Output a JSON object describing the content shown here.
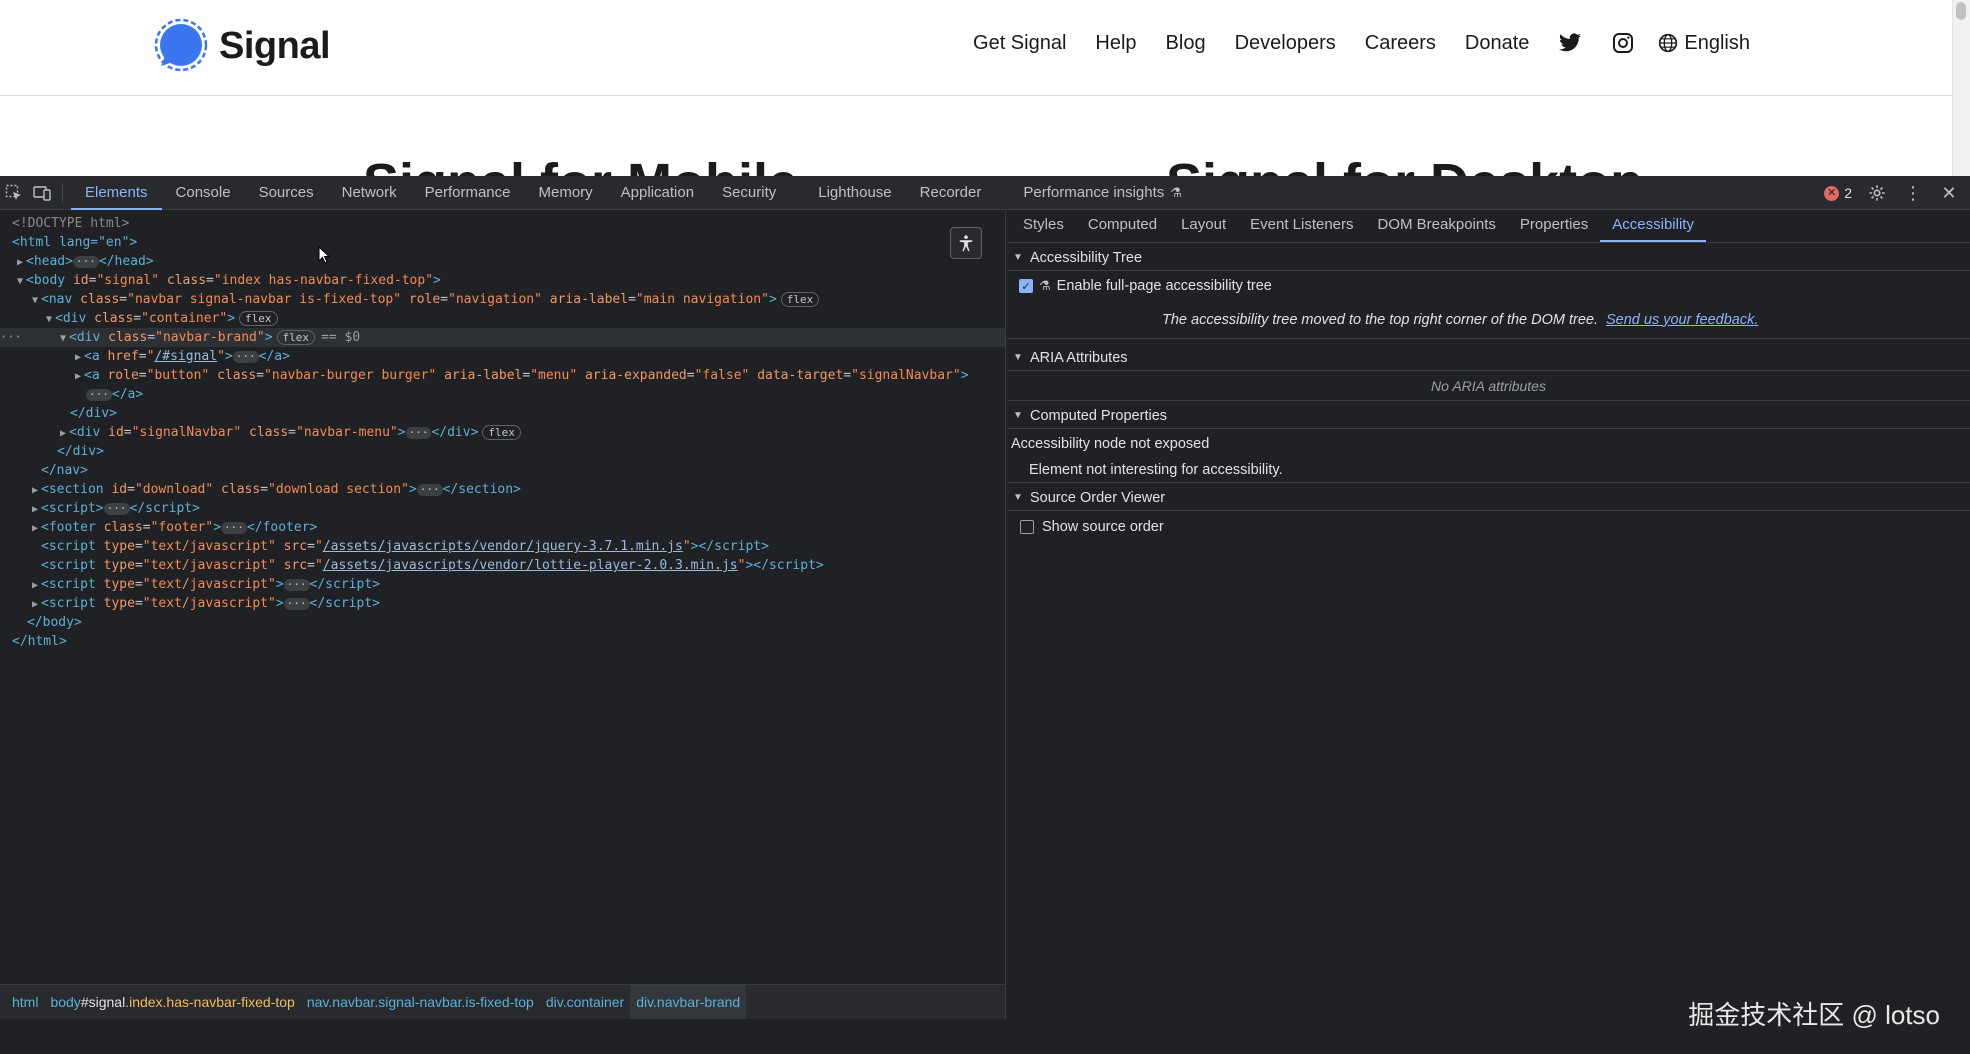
{
  "site": {
    "brand": "Signal",
    "nav": [
      "Get Signal",
      "Help",
      "Blog",
      "Developers",
      "Careers",
      "Donate"
    ],
    "language": "English",
    "headings": [
      "Signal for Mobile",
      "Signal for Desktop"
    ],
    "colors": {
      "brand_blue": "#3a76f0"
    },
    "icons": [
      "twitter-icon",
      "instagram-icon",
      "globe-icon"
    ]
  },
  "devtools": {
    "main_tabs": [
      "Elements",
      "Console",
      "Sources",
      "Network",
      "Performance",
      "Memory",
      "Application",
      "Security",
      "Lighthouse",
      "Recorder",
      "Performance insights"
    ],
    "active_main_tab": "Elements",
    "error_count": "2",
    "dom": {
      "doctype": "<!DOCTYPE html>",
      "html_open": "<html lang=\"en\">",
      "head": "<head>",
      "head_close": "</head>",
      "body_tag": "body",
      "body_id": "signal",
      "body_class": "index has-navbar-fixed-top",
      "nav_class": "navbar signal-navbar is-fixed-top",
      "nav_role": "navigation",
      "nav_aria": "main navigation",
      "container_class": "container",
      "brand_class": "navbar-brand",
      "selected_marker": "== $0",
      "a_href": "/#signal",
      "burger_role": "button",
      "burger_class": "navbar-burger burger",
      "burger_aria_label": "menu",
      "burger_aria_expanded": "false",
      "burger_target": "signalNavbar",
      "menu_id": "signalNavbar",
      "menu_class": "navbar-menu",
      "section_id": "download",
      "section_class": "download section",
      "footer_class": "footer",
      "script_type": "text/javascript",
      "jquery_src": "/assets/javascripts/vendor/jquery-3.7.1.min.js",
      "lottie_src": "/assets/javascripts/vendor/lottie-player-2.0.3.min.js",
      "badge_flex": "flex"
    },
    "breadcrumb": [
      {
        "tag": "html",
        "id": "",
        "cls": ""
      },
      {
        "tag": "body",
        "id": "#signal",
        "cls": ".index.has-navbar-fixed-top"
      },
      {
        "tag": "nav",
        "id": "",
        "cls": ".navbar.signal-navbar.is-fixed-top"
      },
      {
        "tag": "div",
        "id": "",
        "cls": ".container"
      },
      {
        "tag": "div",
        "id": "",
        "cls": ".navbar-brand"
      }
    ],
    "side_tabs": [
      "Styles",
      "Computed",
      "Layout",
      "Event Listeners",
      "DOM Breakpoints",
      "Properties",
      "Accessibility"
    ],
    "active_side_tab": "Accessibility",
    "accessibility": {
      "tree_header": "Accessibility Tree",
      "enable_label": "Enable full-page accessibility tree",
      "enable_checked": true,
      "moved_note": "The accessibility tree moved to the top right corner of the DOM tree.",
      "feedback_link": "Send us your feedback.",
      "aria_header": "ARIA Attributes",
      "aria_empty": "No ARIA attributes",
      "computed_header": "Computed Properties",
      "node_not_exposed": "Accessibility node not exposed",
      "not_interesting": "Element not interesting for accessibility.",
      "source_order_header": "Source Order Viewer",
      "show_source_order": "Show source order",
      "show_source_order_checked": false
    },
    "watermark": "掘金技术社区 @ lotso"
  }
}
